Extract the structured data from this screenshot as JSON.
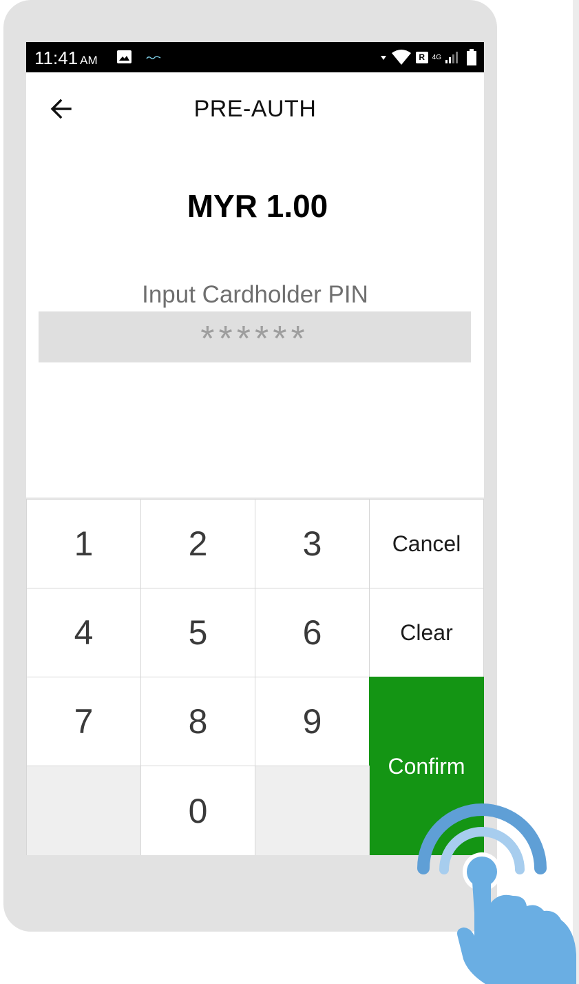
{
  "status_bar": {
    "time": "11:41",
    "ampm": "AM",
    "roaming_badge": "R",
    "network_type": "4G"
  },
  "header": {
    "title": "PRE-AUTH",
    "back_icon": "arrow-left-icon"
  },
  "transaction": {
    "amount": "MYR 1.00"
  },
  "pin_entry": {
    "label": "Input Cardholder PIN",
    "masked_value": "******"
  },
  "keypad": {
    "digits": [
      "1",
      "2",
      "3",
      "4",
      "5",
      "6",
      "7",
      "8",
      "9",
      "0"
    ],
    "cancel_label": "Cancel",
    "clear_label": "Clear",
    "confirm_label": "Confirm"
  },
  "colors": {
    "confirm_green": "#149514",
    "pin_field_bg": "#dfdfdf",
    "device_frame": "#e2e2e2",
    "tap_icon_blue": "#6aaee3"
  },
  "overlay": {
    "icon": "tap-hand-icon"
  }
}
